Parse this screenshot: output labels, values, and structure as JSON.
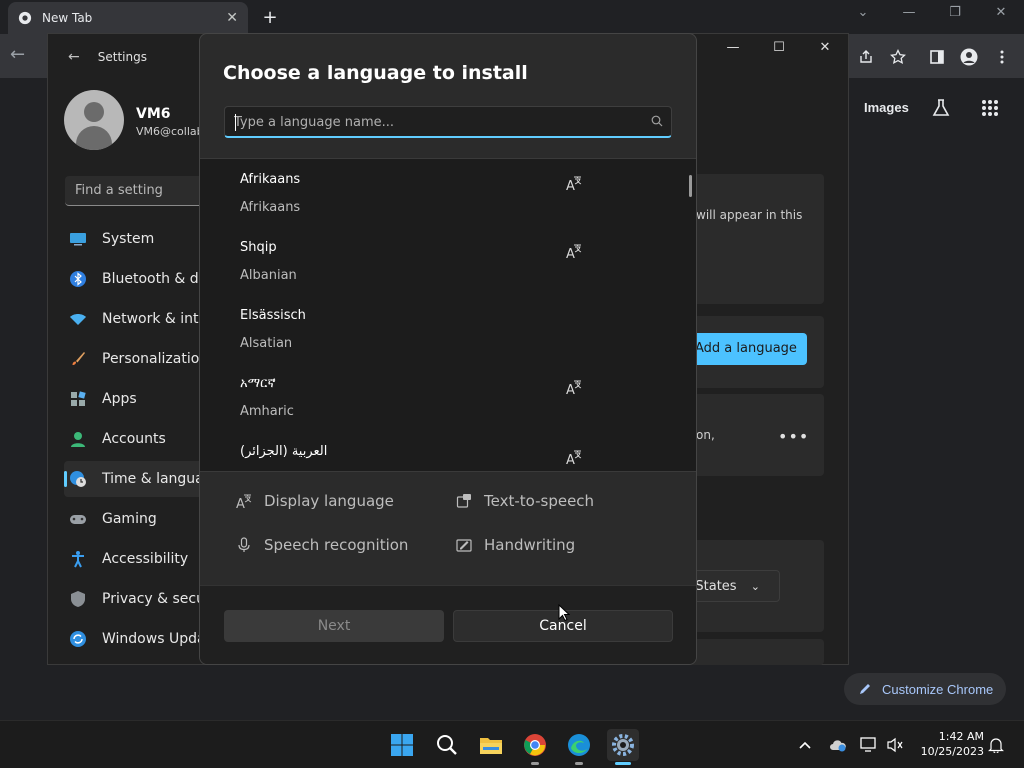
{
  "browser": {
    "tab_title": "New Tab",
    "images_link": "Images",
    "customize_label": "Customize Chrome"
  },
  "settings": {
    "title": "Settings",
    "user_name": "VM6",
    "user_email": "VM6@collab",
    "search_placeholder": "Find a setting",
    "nav": [
      {
        "label": "System",
        "icon": "monitor-icon"
      },
      {
        "label": "Bluetooth & devices",
        "icon": "bluetooth-icon"
      },
      {
        "label": "Network & internet",
        "icon": "wifi-icon"
      },
      {
        "label": "Personalization",
        "icon": "brush-icon"
      },
      {
        "label": "Apps",
        "icon": "apps-icon"
      },
      {
        "label": "Accounts",
        "icon": "person-icon"
      },
      {
        "label": "Time & language",
        "icon": "globe-clock-icon"
      },
      {
        "label": "Gaming",
        "icon": "gamepad-icon"
      },
      {
        "label": "Accessibility",
        "icon": "accessibility-icon"
      },
      {
        "label": "Privacy & security",
        "icon": "shield-icon"
      },
      {
        "label": "Windows Update",
        "icon": "update-icon"
      }
    ],
    "bg_text_1": "will appear in this",
    "bg_text_2": "on,",
    "add_language_label": "Add a language",
    "region_value": "d States"
  },
  "dialog": {
    "title": "Choose a language to install",
    "search_placeholder": "Type a language name...",
    "languages": [
      {
        "native": "Afrikaans",
        "english": "Afrikaans",
        "display_language": true
      },
      {
        "native": "Shqip",
        "english": "Albanian",
        "display_language": true
      },
      {
        "native": "Elsässisch",
        "english": "Alsatian",
        "display_language": false
      },
      {
        "native": "አማርኛ",
        "english": "Amharic",
        "display_language": true
      },
      {
        "native": "العربية (الجزائر)",
        "english": "",
        "display_language": true
      }
    ],
    "legend": {
      "display_language": "Display language",
      "text_to_speech": "Text-to-speech",
      "speech_recognition": "Speech recognition",
      "handwriting": "Handwriting"
    },
    "next_label": "Next",
    "cancel_label": "Cancel"
  },
  "taskbar": {
    "time": "1:42 AM",
    "date": "10/25/2023"
  }
}
